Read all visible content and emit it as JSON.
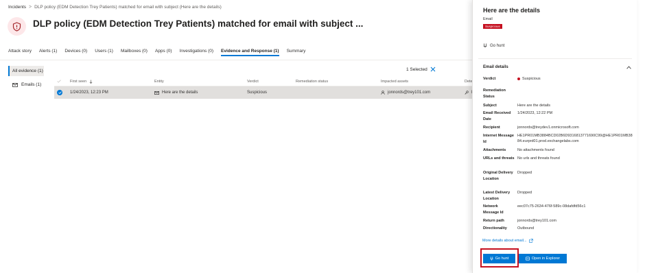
{
  "breadcrumb": {
    "root": "Incidents",
    "separator": ">",
    "current": "DLP policy (EDM Detection Trey Patients) matched for email with subject (Here are the details)"
  },
  "header": {
    "icon": "shield-icon",
    "title": "DLP policy (EDM Detection Trey Patients) matched for email with subject ..."
  },
  "tabs": [
    {
      "label": "Attack story",
      "active": false
    },
    {
      "label": "Alerts (1)",
      "active": false
    },
    {
      "label": "Devices (0)",
      "active": false
    },
    {
      "label": "Users (1)",
      "active": false
    },
    {
      "label": "Mailboxes (0)",
      "active": false
    },
    {
      "label": "Apps (0)",
      "active": false
    },
    {
      "label": "Investigations (0)",
      "active": false
    },
    {
      "label": "Evidence and Response (1)",
      "active": true
    },
    {
      "label": "Summary",
      "active": false
    }
  ],
  "left_nav": {
    "all_evidence": "All evidence (1)",
    "emails": "Emails (1)"
  },
  "selection": {
    "label": "1 Selected"
  },
  "grid": {
    "columns": [
      "First seen",
      "Entity",
      "Verdict",
      "Remediation status",
      "Impacted assets",
      "Dete"
    ],
    "rows": [
      {
        "first_seen": "1/24/2023, 12:23 PM",
        "entity": "Here are the details",
        "verdict": "Suspicious",
        "remediation_status": "",
        "impacted_assets": "jonnords@trey101.com",
        "detection": "D"
      }
    ]
  },
  "panel": {
    "title": "Here are the details",
    "subtitle": "Email",
    "badge": "Suspicious",
    "go_hunt_link": "Go hunt",
    "section_title": "Email details",
    "fields": {
      "verdict_label": "Verdict",
      "verdict_value": "Suspicious",
      "remediation_label": "Remediation Status",
      "subject_label": "Subject",
      "subject_value": "Here are the details",
      "received_label": "Email Received Date",
      "received_value": "1/24/2023, 12:22 PM",
      "recipient_label": "Recipient",
      "recipient_value": "jonnords@treydev1.onmicrosoft.com",
      "message_id_label": "Internet Message Id",
      "message_id_value_1": "HE1PR01MB3884BCD02B6D9316813771690C99@HE1PR01MB38",
      "message_id_value_2": "84.eurprd01.prod.exchangelabs.com",
      "attachments_label": "Attachments",
      "attachments_value": "No attachments found",
      "urls_label": "URLs and threats",
      "urls_value": "No urls and threats found",
      "original_location_label": "Original Delivery Location",
      "original_location_value": "Dropped",
      "latest_location_label": "Latest Delivery Location",
      "latest_location_value": "Dropped",
      "network_id_label": "Network Message Id",
      "network_id_value": "eec07c75-2634-476f-589c-08dafdfd56c1",
      "return_path_label": "Return path",
      "return_path_value": "jonnords@trey101.com",
      "directionality_label": "Directionality",
      "directionality_value": "Outbound"
    },
    "more_details": "More details about email...",
    "buttons": {
      "go_hunt": "Go hunt",
      "open_explorer": "Open in Explorer"
    }
  },
  "colors": {
    "accent": "#0078d4",
    "danger": "#c50f1f",
    "icon_bg": "#fde7e9"
  }
}
